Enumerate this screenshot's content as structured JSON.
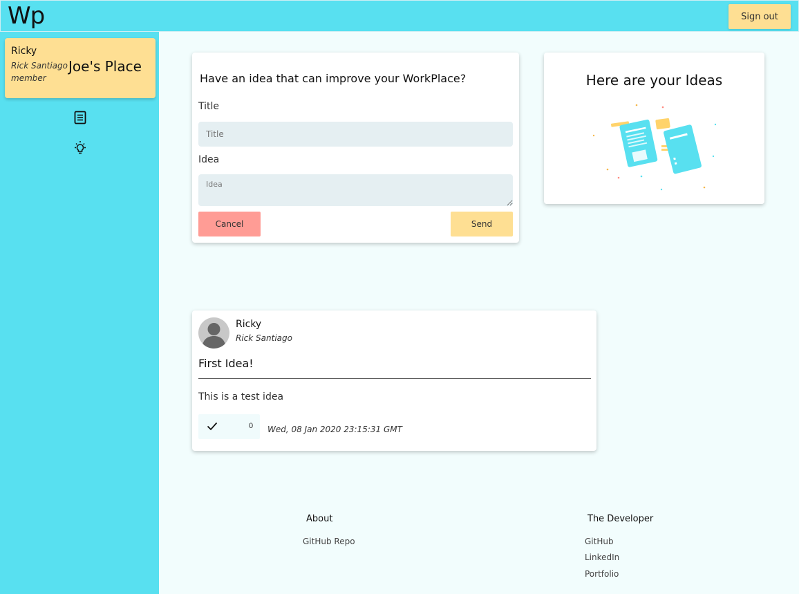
{
  "app": {
    "logo": "Wp",
    "signout_label": "Sign out"
  },
  "sidebar": {
    "profile": {
      "name": "Ricky",
      "full_name": "Rick Santiago",
      "role": "member",
      "place": "Joe's Place"
    },
    "nav": [
      {
        "icon": "document-list-icon"
      },
      {
        "icon": "lightbulb-icon"
      }
    ]
  },
  "form": {
    "heading": "Have an idea that can improve your WorkPlace?",
    "title_label": "Title",
    "title_placeholder": "Title",
    "idea_label": "Idea",
    "idea_placeholder": "Idea",
    "cancel_label": "Cancel",
    "send_label": "Send"
  },
  "ideas_panel": {
    "heading": "Here are your Ideas",
    "illustration": "documents-illustration"
  },
  "idea_post": {
    "author_name": "Ricky",
    "author_full_name": "Rick Santiago",
    "title": "First Idea!",
    "body": "This is a test idea",
    "approvals": "0",
    "date": "Wed, 08 Jan 2020 23:15:31 GMT"
  },
  "footer": {
    "about": {
      "heading": "About",
      "links": [
        "GitHub Repo"
      ]
    },
    "developer": {
      "heading": "The Developer",
      "links": [
        "GitHub",
        "LinkedIn",
        "Portfolio"
      ]
    }
  },
  "colors": {
    "cyan": "#58e0f0",
    "yellow": "#fedf93",
    "salmon": "#ff9c95",
    "page_bg": "#f2fdfd"
  }
}
